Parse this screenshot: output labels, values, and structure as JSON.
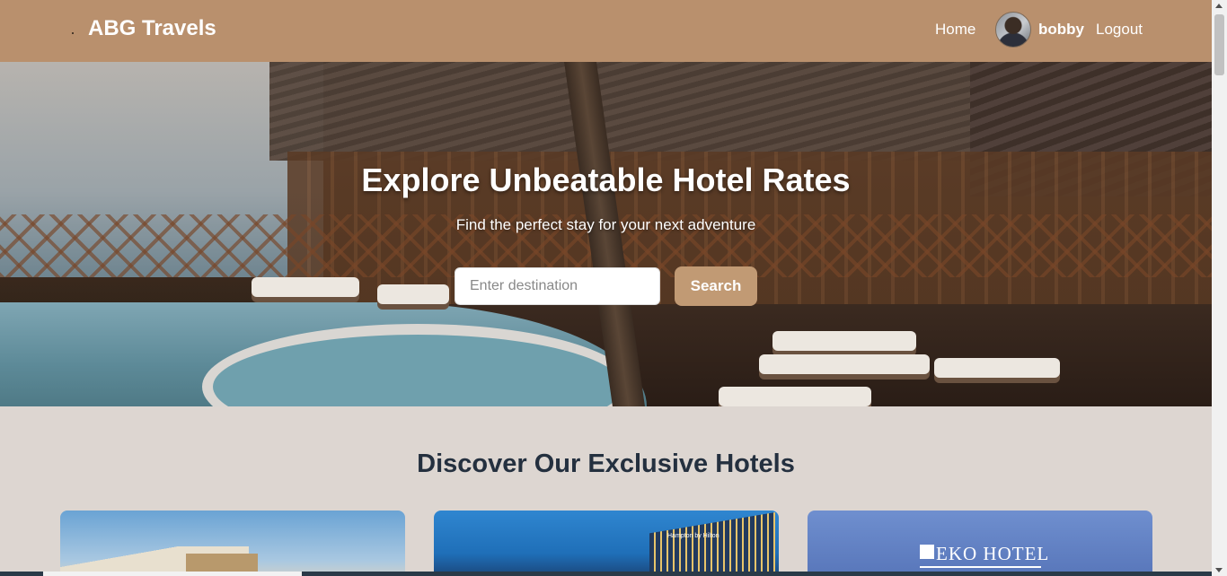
{
  "navbar": {
    "brand": "ABG Travels",
    "home_label": "Home",
    "username": "bobby",
    "logout_label": "Logout"
  },
  "hero": {
    "title": "Explore Unbeatable Hotel Rates",
    "subtitle": "Find the perfect stay for your next adventure",
    "search_placeholder": "Enter destination",
    "search_value": "",
    "search_button": "Search"
  },
  "section": {
    "title": "Discover Our Exclusive Hotels"
  },
  "cards": [
    {
      "image": "hotel-photo-building"
    },
    {
      "image": "hotel-photo-tower",
      "sign_text": "Hampton by Hilton"
    },
    {
      "image": "hotel-logo",
      "logo_text": "EKO HOTEL"
    }
  ],
  "colors": {
    "navbar_bg": "#b9906d",
    "accent_button": "#c19a74",
    "page_bg": "#ddd6d1",
    "heading_text": "#24303f"
  }
}
